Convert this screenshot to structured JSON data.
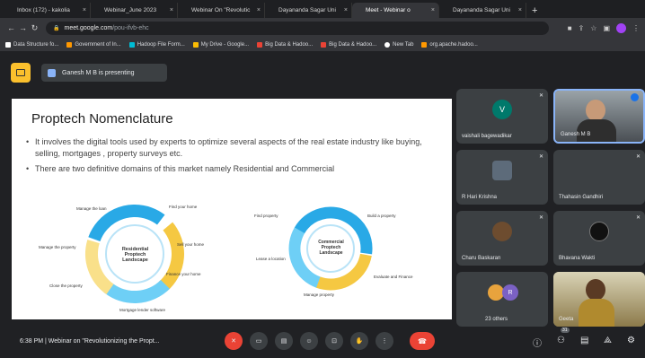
{
  "tabs": [
    {
      "label": "Inbox (172) - kakolia",
      "color": "#ea4335"
    },
    {
      "label": "Webinar_June 2023",
      "color": "#fbbc04"
    },
    {
      "label": "Webinar On \"Revolutic",
      "color": "#34a853"
    },
    {
      "label": "Dayananda Sagar Uni",
      "color": "#fbbc04"
    },
    {
      "label": "Meet - Webinar o",
      "color": "#00897b"
    },
    {
      "label": "Dayananda Sagar Uni",
      "color": "#4285f4"
    }
  ],
  "addressbar": {
    "url_main": "meet.google.com",
    "url_path": "/pou-ifvb-ehc"
  },
  "bookmarks": [
    {
      "label": "Data Structure fo...",
      "color": "#ffffff"
    },
    {
      "label": "Government of In...",
      "color": "#ff9800"
    },
    {
      "label": "Hadoop File Form...",
      "color": "#00bcd4"
    },
    {
      "label": "My Drive - Google...",
      "color": "#fbbc04"
    },
    {
      "label": "Big Data & Hadoo...",
      "color": "#ea4335"
    },
    {
      "label": "Big Data & Hadoo...",
      "color": "#ea4335"
    },
    {
      "label": "New Tab",
      "color": "#ffffff"
    },
    {
      "label": "org.apache.hadoo...",
      "color": "#ff9800"
    }
  ],
  "presenter": {
    "text": "Ganesh M B is presenting"
  },
  "slide": {
    "title": "Proptech Nomenclature",
    "bullet1": "It involves the digital tools used by experts to optimize several aspects of the real estate industry like buying, selling, mortgages , property surveys etc.",
    "bullet2": "There are two definitive domains of this market namely Residential and Commercial",
    "res_center": "Residential Proptech Landscape",
    "res_labels": [
      "Manage the loan",
      "Find your home",
      "Manage the property",
      "Sell your home",
      "Close the property",
      "Finance your home",
      "Mortgage lender software"
    ],
    "com_center": "Commercial Proptech Landscape",
    "com_labels": [
      "Find property",
      "Build a property",
      "Lease a location",
      "Evaluate and Finance",
      "Manage property"
    ]
  },
  "participants": [
    {
      "name": "vaishali bagewadikar",
      "initial": "V",
      "avatar_color": "#00796b",
      "kind": "initial"
    },
    {
      "name": "Ganesh M B",
      "kind": "video"
    },
    {
      "name": "R Hari Krishna",
      "kind": "photo",
      "avatar_color": "#5d6b7a"
    },
    {
      "name": "Thahasin Gandhiri",
      "kind": "none"
    },
    {
      "name": "Charu Baskaran",
      "kind": "photo",
      "avatar_color": "#6d4c2f"
    },
    {
      "name": "Bhavana Wakti",
      "kind": "photo",
      "avatar_color": "#111111"
    },
    {
      "name": "23 others",
      "initial": "R",
      "avatar_color": "#7b61c4",
      "kind": "group"
    },
    {
      "name": "Geeta",
      "kind": "video2"
    }
  ],
  "toolbar": {
    "time": "6:38 PM",
    "meeting": "Webinar on \"Revolutionizing the Propt...",
    "participants_count": "31"
  }
}
